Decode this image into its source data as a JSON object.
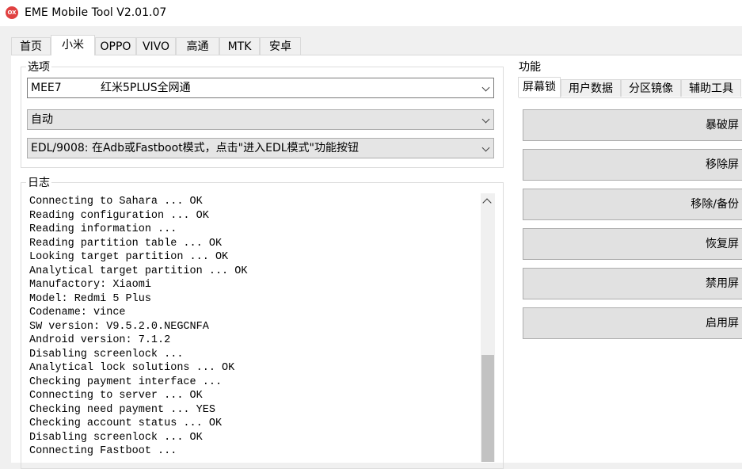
{
  "window": {
    "icon_label": "OX",
    "title": "EME Mobile Tool V2.01.07"
  },
  "main_tabs": [
    "首页",
    "小米",
    "OPPO",
    "VIVO",
    "高通",
    "MTK",
    "安卓"
  ],
  "options": {
    "title": "选项",
    "model_code": "MEE7",
    "model_name": "红米5PLUS全网通",
    "mode": "自动",
    "edl_method": "EDL/9008: 在Adb或Fastboot模式，点击\"进入EDL模式\"功能按钮"
  },
  "log": {
    "title": "日志",
    "lines": [
      "Connecting to Sahara ... OK",
      "Reading configuration ... OK",
      "Reading information ...",
      "Reading partition table ... OK",
      "Looking target partition ... OK",
      "Analytical target partition ... OK",
      "Manufactory: Xiaomi",
      "Model: Redmi 5 Plus",
      "Codename: vince",
      "SW version: V9.5.2.0.NEGCNFA",
      "Android version: 7.1.2",
      "Disabling screenlock ...",
      "Analytical lock solutions ... OK",
      "Checking payment interface ...",
      "Connecting to server ... OK",
      "Checking need payment ... YES",
      "Checking account status ... OK",
      "Disabling screenlock ... OK",
      "",
      "Connecting Fastboot ..."
    ]
  },
  "functions": {
    "title": "功能",
    "tabs": [
      "屏幕锁",
      "用户数据",
      "分区镜像",
      "辅助工具"
    ],
    "buttons": [
      "暴破屏",
      "移除屏",
      "移除/备份",
      "恢复屏",
      "禁用屏",
      "启用屏"
    ]
  }
}
